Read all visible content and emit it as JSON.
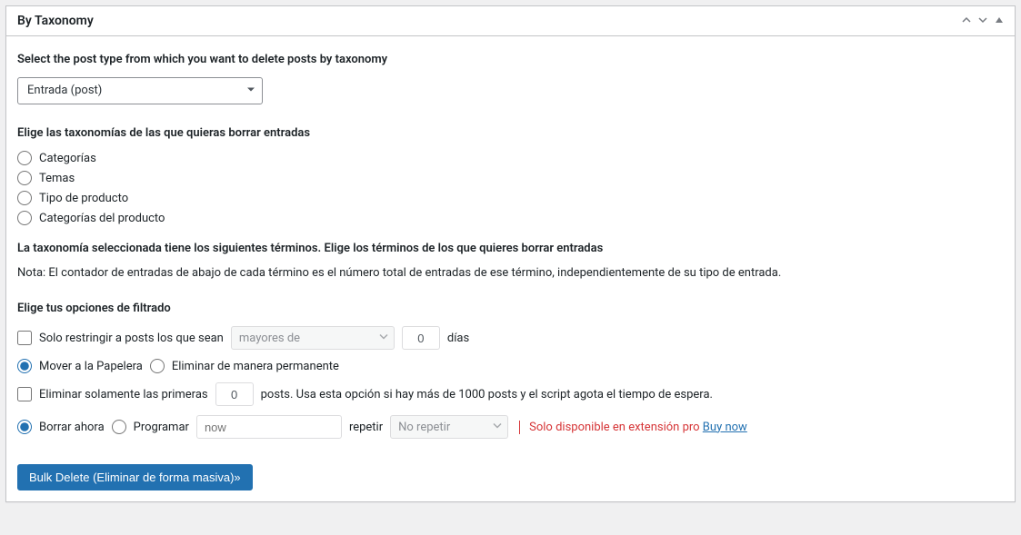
{
  "panel": {
    "title": "By Taxonomy"
  },
  "post_type": {
    "label": "Select the post type from which you want to delete posts by taxonomy",
    "selected": "Entrada (post)"
  },
  "taxonomies": {
    "label": "Elige las taxonomías de las que quieras borrar entradas",
    "options": [
      "Categorías",
      "Temas",
      "Tipo de producto",
      "Categorías del producto"
    ]
  },
  "terms": {
    "label": "La taxonomía seleccionada tiene los siguientes términos. Elige los términos de los que quieres borrar entradas",
    "note": "Nota: El contador de entradas de abajo de cada término es el número total de entradas de ese término, independientemente de su tipo de entrada."
  },
  "filters": {
    "label": "Elige tus opciones de filtrado",
    "restrict_label": "Solo restringir a posts los que sean",
    "age_select": "mayores de",
    "age_value": "0",
    "age_unit": "días",
    "trash_label": "Mover a la Papelera",
    "perm_label": "Eliminar de manera permanente",
    "limit_label": "Eliminar solamente las primeras",
    "limit_value": "0",
    "limit_suffix": "posts. Usa esta opción si hay más de 1000 posts y el script agota el tiempo de espera.",
    "now_label": "Borrar ahora",
    "schedule_label": "Programar",
    "schedule_value": "now",
    "repeat_label": "repetir",
    "repeat_select": "No repetir",
    "pro_text": "Solo disponible en extensión pro",
    "buy_link": "Buy now"
  },
  "submit": {
    "label": "Bulk Delete (Eliminar de forma masiva)»"
  }
}
